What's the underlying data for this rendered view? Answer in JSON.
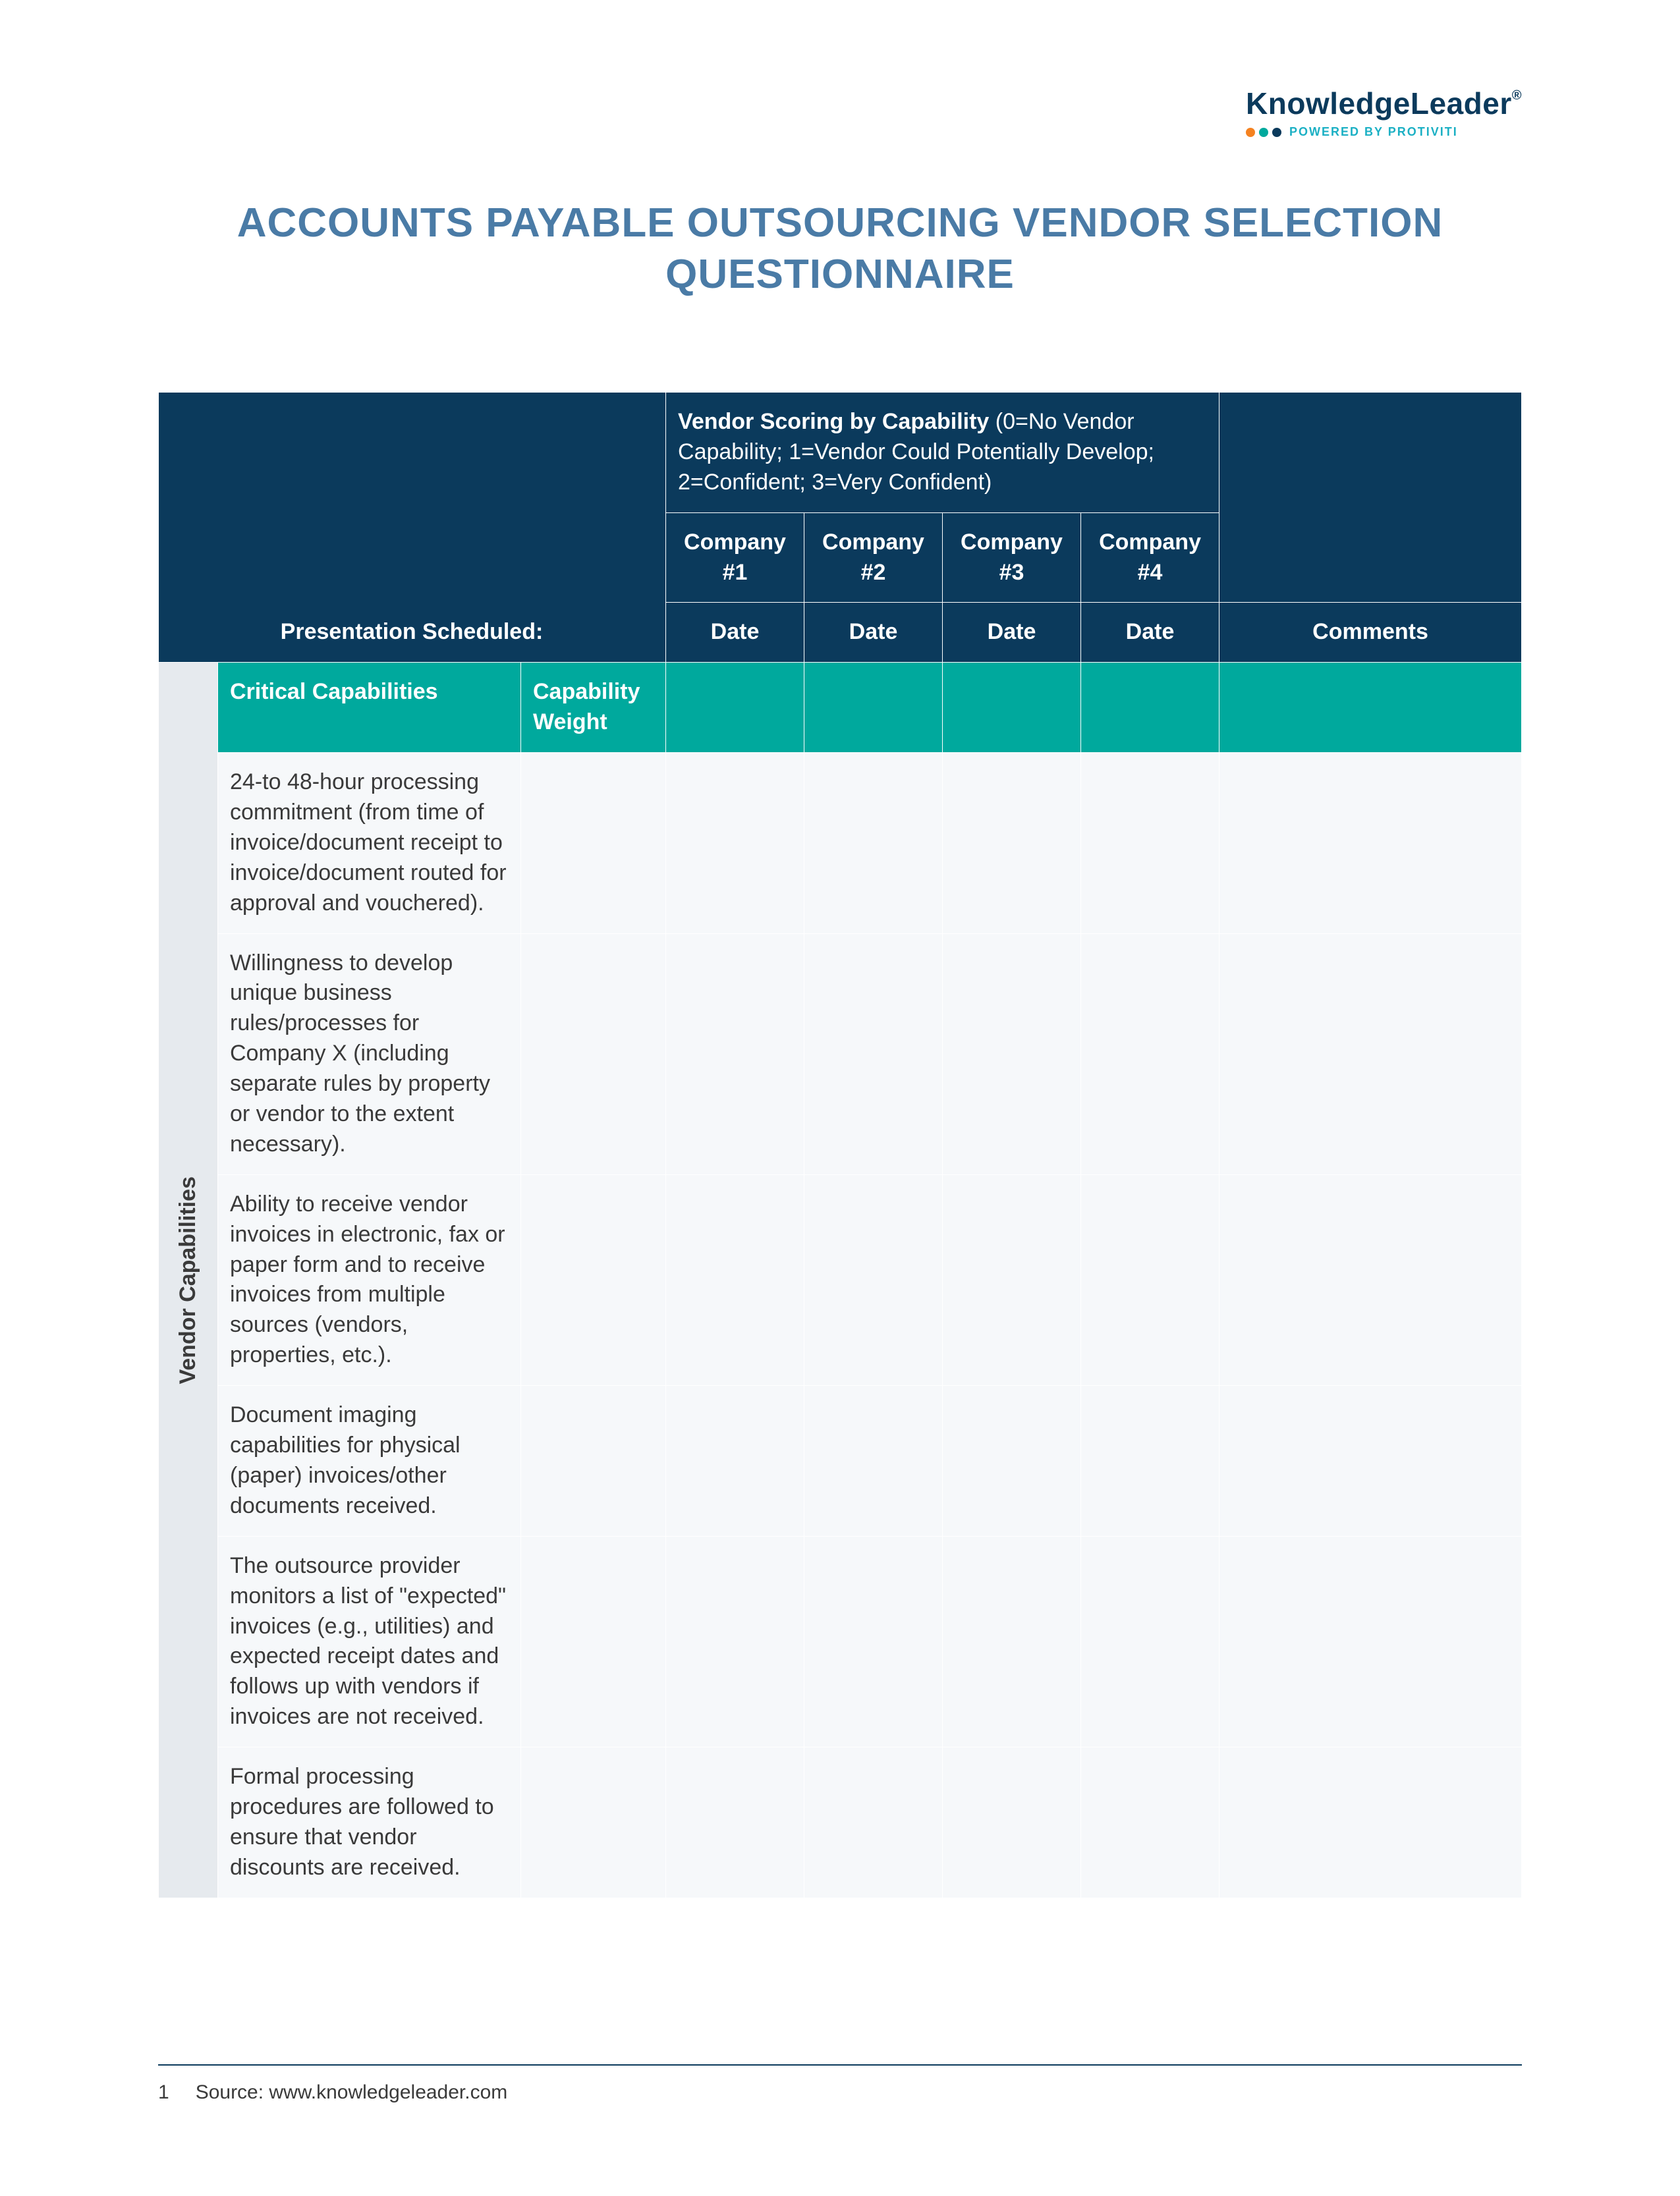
{
  "brand": {
    "name": "KnowledgeLeader",
    "reg": "®",
    "tagline": "POWERED BY PROTIVITI"
  },
  "title": "ACCOUNTS PAYABLE OUTSOURCING VENDOR SELECTION QUESTIONNAIRE",
  "header": {
    "scoring_label": "Vendor Scoring by Capability",
    "scoring_scale": "(0=No Vendor Capability; 1=Vendor Could Potentially Develop; 2=Confident; 3=Very Confident)",
    "companies": [
      "Company #1",
      "Company #2",
      "Company #3",
      "Company #4"
    ],
    "presentation_label": "Presentation Scheduled:",
    "date_label": "Date",
    "comments_label": "Comments"
  },
  "section": {
    "sidebar_label": "Vendor Capabilities",
    "col_capabilities": "Critical Capabilities",
    "col_weight": "Capability Weight"
  },
  "rows": [
    {
      "text": "24-to 48-hour processing commitment (from time of invoice/document receipt to invoice/document routed for approval and vouchered)."
    },
    {
      "text": "Willingness to develop unique business rules/processes for Company X (including separate rules by property or vendor to the extent necessary)."
    },
    {
      "text": "Ability to receive vendor invoices in electronic, fax or paper form and to receive invoices from multiple sources (vendors, properties, etc.)."
    },
    {
      "text": "Document imaging capabilities for physical (paper) invoices/other documents received."
    },
    {
      "text": "The outsource provider monitors a list of \"expected\" invoices (e.g., utilities) and expected receipt dates and follows up with vendors if invoices are not received."
    },
    {
      "text": "Formal processing procedures are followed to ensure that vendor discounts are received."
    }
  ],
  "footer": {
    "page": "1",
    "source": "Source: www.knowledgeleader.com"
  }
}
